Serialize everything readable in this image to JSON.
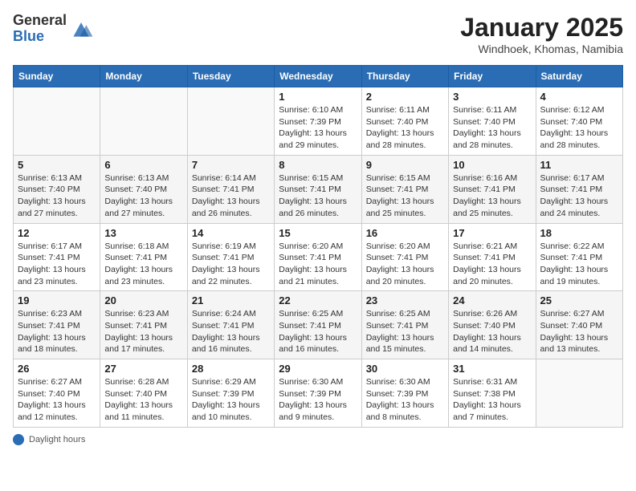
{
  "header": {
    "logo_general": "General",
    "logo_blue": "Blue",
    "month_title": "January 2025",
    "location": "Windhoek, Khomas, Namibia"
  },
  "calendar": {
    "days_header": [
      "Sunday",
      "Monday",
      "Tuesday",
      "Wednesday",
      "Thursday",
      "Friday",
      "Saturday"
    ],
    "weeks": [
      [
        {
          "day": "",
          "info": ""
        },
        {
          "day": "",
          "info": ""
        },
        {
          "day": "",
          "info": ""
        },
        {
          "day": "1",
          "info": "Sunrise: 6:10 AM\nSunset: 7:39 PM\nDaylight: 13 hours and 29 minutes."
        },
        {
          "day": "2",
          "info": "Sunrise: 6:11 AM\nSunset: 7:40 PM\nDaylight: 13 hours and 28 minutes."
        },
        {
          "day": "3",
          "info": "Sunrise: 6:11 AM\nSunset: 7:40 PM\nDaylight: 13 hours and 28 minutes."
        },
        {
          "day": "4",
          "info": "Sunrise: 6:12 AM\nSunset: 7:40 PM\nDaylight: 13 hours and 28 minutes."
        }
      ],
      [
        {
          "day": "5",
          "info": "Sunrise: 6:13 AM\nSunset: 7:40 PM\nDaylight: 13 hours and 27 minutes."
        },
        {
          "day": "6",
          "info": "Sunrise: 6:13 AM\nSunset: 7:40 PM\nDaylight: 13 hours and 27 minutes."
        },
        {
          "day": "7",
          "info": "Sunrise: 6:14 AM\nSunset: 7:41 PM\nDaylight: 13 hours and 26 minutes."
        },
        {
          "day": "8",
          "info": "Sunrise: 6:15 AM\nSunset: 7:41 PM\nDaylight: 13 hours and 26 minutes."
        },
        {
          "day": "9",
          "info": "Sunrise: 6:15 AM\nSunset: 7:41 PM\nDaylight: 13 hours and 25 minutes."
        },
        {
          "day": "10",
          "info": "Sunrise: 6:16 AM\nSunset: 7:41 PM\nDaylight: 13 hours and 25 minutes."
        },
        {
          "day": "11",
          "info": "Sunrise: 6:17 AM\nSunset: 7:41 PM\nDaylight: 13 hours and 24 minutes."
        }
      ],
      [
        {
          "day": "12",
          "info": "Sunrise: 6:17 AM\nSunset: 7:41 PM\nDaylight: 13 hours and 23 minutes."
        },
        {
          "day": "13",
          "info": "Sunrise: 6:18 AM\nSunset: 7:41 PM\nDaylight: 13 hours and 23 minutes."
        },
        {
          "day": "14",
          "info": "Sunrise: 6:19 AM\nSunset: 7:41 PM\nDaylight: 13 hours and 22 minutes."
        },
        {
          "day": "15",
          "info": "Sunrise: 6:20 AM\nSunset: 7:41 PM\nDaylight: 13 hours and 21 minutes."
        },
        {
          "day": "16",
          "info": "Sunrise: 6:20 AM\nSunset: 7:41 PM\nDaylight: 13 hours and 20 minutes."
        },
        {
          "day": "17",
          "info": "Sunrise: 6:21 AM\nSunset: 7:41 PM\nDaylight: 13 hours and 20 minutes."
        },
        {
          "day": "18",
          "info": "Sunrise: 6:22 AM\nSunset: 7:41 PM\nDaylight: 13 hours and 19 minutes."
        }
      ],
      [
        {
          "day": "19",
          "info": "Sunrise: 6:23 AM\nSunset: 7:41 PM\nDaylight: 13 hours and 18 minutes."
        },
        {
          "day": "20",
          "info": "Sunrise: 6:23 AM\nSunset: 7:41 PM\nDaylight: 13 hours and 17 minutes."
        },
        {
          "day": "21",
          "info": "Sunrise: 6:24 AM\nSunset: 7:41 PM\nDaylight: 13 hours and 16 minutes."
        },
        {
          "day": "22",
          "info": "Sunrise: 6:25 AM\nSunset: 7:41 PM\nDaylight: 13 hours and 16 minutes."
        },
        {
          "day": "23",
          "info": "Sunrise: 6:25 AM\nSunset: 7:41 PM\nDaylight: 13 hours and 15 minutes."
        },
        {
          "day": "24",
          "info": "Sunrise: 6:26 AM\nSunset: 7:40 PM\nDaylight: 13 hours and 14 minutes."
        },
        {
          "day": "25",
          "info": "Sunrise: 6:27 AM\nSunset: 7:40 PM\nDaylight: 13 hours and 13 minutes."
        }
      ],
      [
        {
          "day": "26",
          "info": "Sunrise: 6:27 AM\nSunset: 7:40 PM\nDaylight: 13 hours and 12 minutes."
        },
        {
          "day": "27",
          "info": "Sunrise: 6:28 AM\nSunset: 7:40 PM\nDaylight: 13 hours and 11 minutes."
        },
        {
          "day": "28",
          "info": "Sunrise: 6:29 AM\nSunset: 7:39 PM\nDaylight: 13 hours and 10 minutes."
        },
        {
          "day": "29",
          "info": "Sunrise: 6:30 AM\nSunset: 7:39 PM\nDaylight: 13 hours and 9 minutes."
        },
        {
          "day": "30",
          "info": "Sunrise: 6:30 AM\nSunset: 7:39 PM\nDaylight: 13 hours and 8 minutes."
        },
        {
          "day": "31",
          "info": "Sunrise: 6:31 AM\nSunset: 7:38 PM\nDaylight: 13 hours and 7 minutes."
        },
        {
          "day": "",
          "info": ""
        }
      ]
    ]
  },
  "footer": {
    "daylight_label": "Daylight hours"
  }
}
